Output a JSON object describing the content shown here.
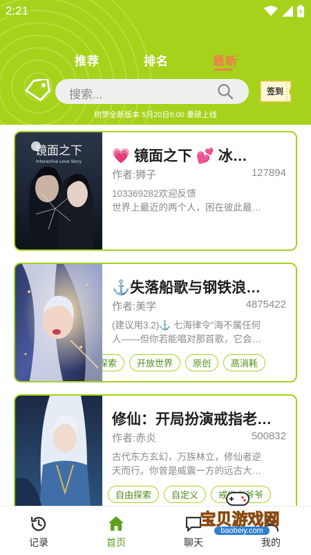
{
  "status": {
    "time": "2:21"
  },
  "tabs": [
    {
      "label": "推荐",
      "active": false
    },
    {
      "label": "排名",
      "active": false
    },
    {
      "label": "最新",
      "active": true
    }
  ],
  "search": {
    "placeholder": "搜索..."
  },
  "checkin": {
    "label": "签到"
  },
  "notice": "树梦全新版本 5月20日6:00 重磅上线",
  "cards": [
    {
      "title": "💗 镜面之下  💕 冰…",
      "author": "作者:狮子",
      "count": "127894",
      "desc_line1": "103369282欢迎反馈",
      "desc_line2": "世界上最近的两个人，困在彼此最…",
      "cover_title": "镜面之下",
      "cover_subtitle": "Interactive Love Story",
      "tags": []
    },
    {
      "title": "⚓失落船歌与钢铁浪…",
      "author": "作者:美学",
      "count": "4875422",
      "desc_line1": "(建议用3.2)⚓ 七海律令\"海不属任何",
      "desc_line2": "人——但你若能唱对那首歌，它会…",
      "tags": [
        "探索",
        "开放世界",
        "原创",
        "高消耗"
      ]
    },
    {
      "title": "修仙：开局扮演戒指老…",
      "author": "作者:赤炎",
      "count": "500832",
      "desc_line1": "古代东方玄幻，万族林立，修仙者逆",
      "desc_line2": "天而行。你曾是威震一方的远古大…",
      "tags": [
        "自由探索",
        "自定义",
        "戒指老爷爷"
      ]
    }
  ],
  "nav": [
    {
      "label": "记录",
      "icon": "history-icon"
    },
    {
      "label": "首页",
      "icon": "home-icon",
      "active": true
    },
    {
      "label": "聊天",
      "icon": "chat-icon"
    },
    {
      "label": "我的",
      "icon": "profile-icon"
    }
  ],
  "watermark": {
    "text": "宝贝游戏网",
    "url": "baobeiy.com"
  },
  "colors": {
    "accent": "#a6d21c",
    "active_tab": "#f27b4b",
    "chip_text": "#4e8e1a"
  }
}
